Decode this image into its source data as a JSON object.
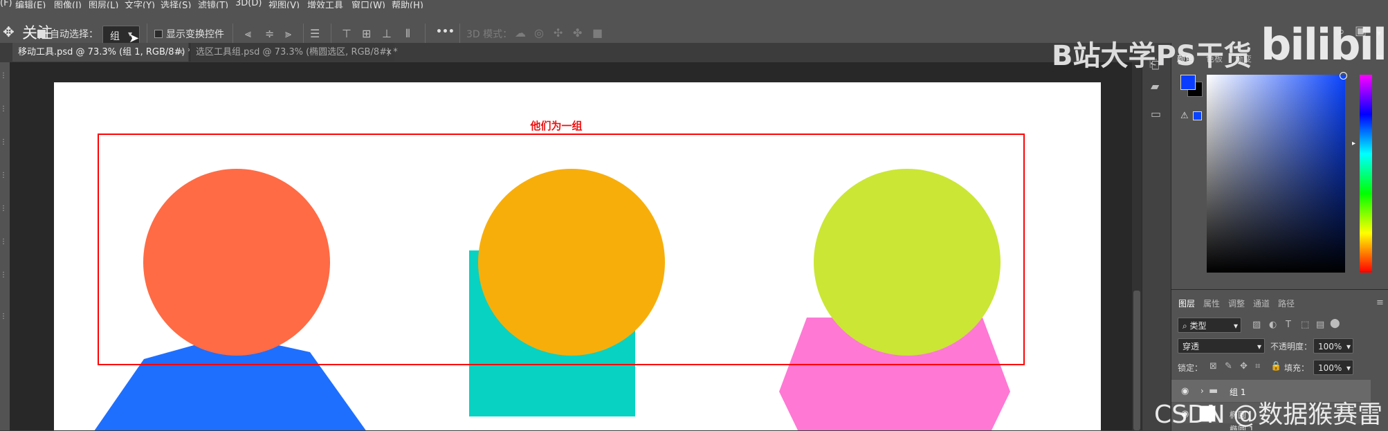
{
  "menubar": {
    "items": [
      "(F)",
      "编辑(E)",
      "图像(I)",
      "图层(L)",
      "文字(Y)",
      "选择(S)",
      "滤镜(T)",
      "3D(D)",
      "视图(V)",
      "增效工具",
      "窗口(W)",
      "帮助(H)"
    ]
  },
  "options": {
    "follow_label": "关注",
    "auto_select_label": "自动选择：",
    "auto_select_value": "组",
    "show_transform_label": "显示变换控件",
    "mode_3d_label": "3D 模式：",
    "more_label": "•••"
  },
  "tabs": [
    {
      "label": "移动工具.psd @ 73.3% (组 1, RGB/8#) *",
      "close": "×"
    },
    {
      "label": "选区工具组.psd @ 73.3% (椭圆选区, RGB/8#) *",
      "close": "×"
    }
  ],
  "canvas": {
    "group_label": "他们为一组",
    "colors": {
      "red_circle": "#ff6b45",
      "orange_circle": "#f8ae0a",
      "lime_circle": "#cbe635",
      "blue_triangle": "#1f6fff",
      "teal_square": "#08d2c2",
      "pink_hexagon": "#ff78d4",
      "group_box": "#ff0000"
    }
  },
  "color_panel": {
    "tabs": [
      "颜色",
      "色板",
      "渐变"
    ],
    "foreground": "#0a3cff",
    "background": "#000000"
  },
  "layers_panel": {
    "tabs": [
      "图层",
      "属性",
      "调整",
      "通道",
      "路径"
    ],
    "filter_label": "类型",
    "blend_mode": "穿透",
    "opacity_label": "不透明度：",
    "opacity_value": "100%",
    "lock_label": "锁定：",
    "fill_label": "填充：",
    "fill_value": "100%",
    "layers": [
      {
        "name": "组 1"
      },
      {
        "name": "椭圆"
      },
      {
        "name": "椭圆 1"
      }
    ]
  },
  "watermarks": {
    "top": "B站大学PS干货",
    "logo": "bilibili",
    "bottom": "CSDN @数据猴赛雷"
  }
}
